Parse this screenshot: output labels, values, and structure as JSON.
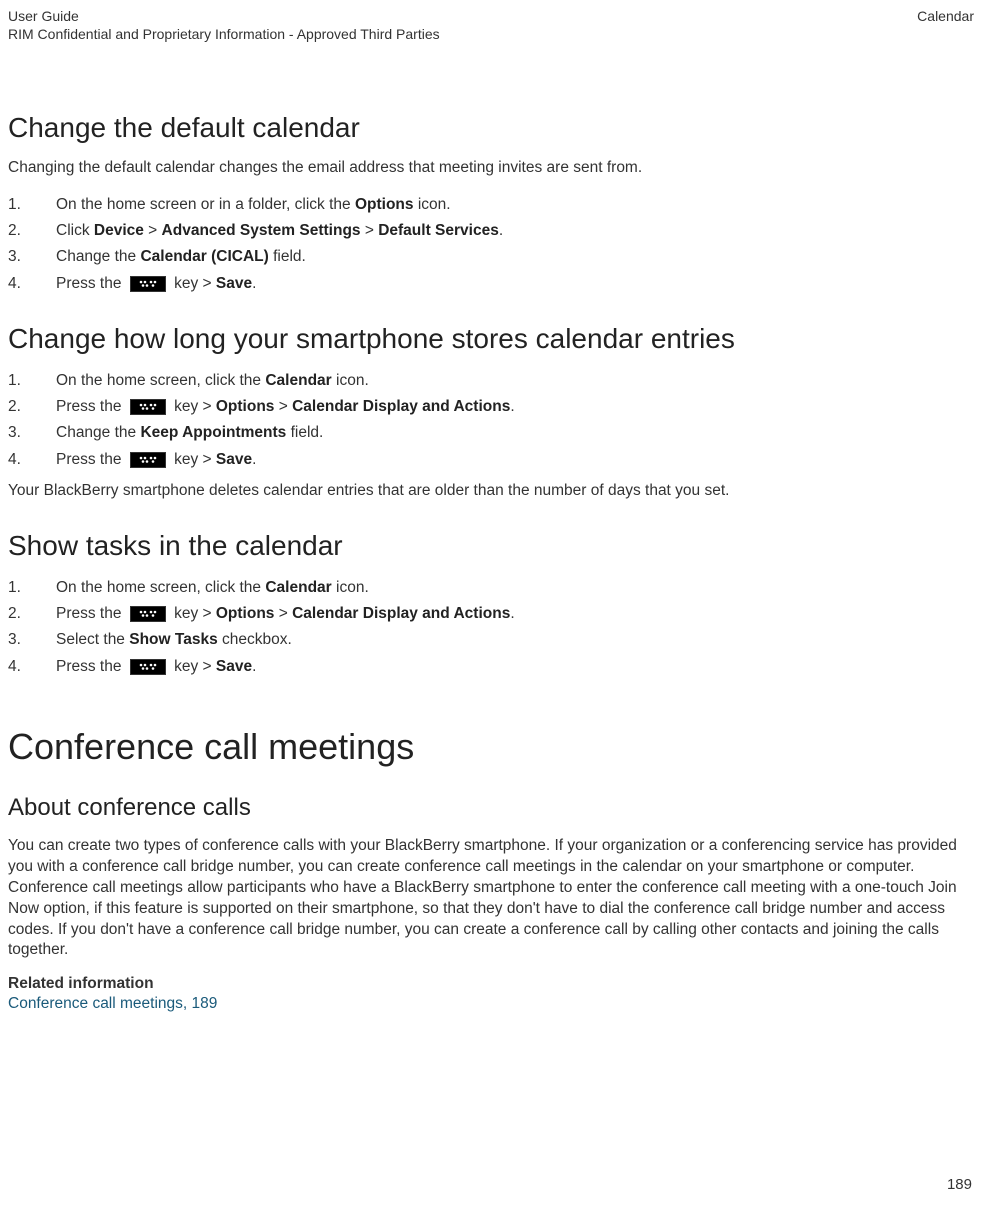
{
  "header": {
    "left": "User Guide",
    "right": "Calendar",
    "sub": "RIM Confidential and Proprietary Information - Approved Third Parties"
  },
  "section1": {
    "title": "Change the default calendar",
    "intro": "Changing the default calendar changes the email address that meeting invites are sent from.",
    "steps": {
      "s1a": "On the home screen or in a folder, click the ",
      "s1b": "Options",
      "s1c": " icon.",
      "s2a": "Click ",
      "s2b": "Device",
      "s2c": " > ",
      "s2d": "Advanced System Settings",
      "s2e": " > ",
      "s2f": "Default Services",
      "s2g": ".",
      "s3a": "Change the ",
      "s3b": "Calendar (CICAL)",
      "s3c": " field.",
      "s4a": "Press the ",
      "s4b": " key > ",
      "s4c": "Save",
      "s4d": "."
    }
  },
  "section2": {
    "title": "Change how long your smartphone stores calendar entries",
    "steps": {
      "s1a": "On the home screen, click the ",
      "s1b": "Calendar",
      "s1c": " icon.",
      "s2a": "Press the ",
      "s2b": " key > ",
      "s2c": "Options",
      "s2d": " > ",
      "s2e": "Calendar Display and Actions",
      "s2f": ".",
      "s3a": "Change the ",
      "s3b": "Keep Appointments",
      "s3c": " field.",
      "s4a": "Press the ",
      "s4b": " key > ",
      "s4c": "Save",
      "s4d": "."
    },
    "note": "Your BlackBerry smartphone deletes calendar entries that are older than the number of days that you set."
  },
  "section3": {
    "title": "Show tasks in the calendar",
    "steps": {
      "s1a": "On the home screen, click the ",
      "s1b": "Calendar",
      "s1c": " icon.",
      "s2a": "Press the ",
      "s2b": " key > ",
      "s2c": "Options",
      "s2d": " > ",
      "s2e": "Calendar Display and Actions",
      "s2f": ".",
      "s3a": "Select the ",
      "s3b": "Show Tasks",
      "s3c": " checkbox.",
      "s4a": "Press the ",
      "s4b": " key > ",
      "s4c": "Save",
      "s4d": "."
    }
  },
  "section4": {
    "title": "Conference call meetings",
    "sub": "About conference calls",
    "body": "You can create two types of conference calls with your BlackBerry smartphone. If your organization or a conferencing service has provided you with a conference call bridge number, you can create conference call meetings in the calendar on your smartphone or computer. Conference call meetings allow participants who have a BlackBerry smartphone to enter the conference call meeting with a one-touch Join Now option, if this feature is supported on their smartphone, so that they don't have to dial the conference call bridge number and access codes. If you don't have a conference call bridge number, you can create a conference call by calling other contacts and joining the calls together.",
    "related_label": "Related information",
    "related_link": "Conference call meetings, ",
    "related_page": "189"
  },
  "page_number": "189"
}
